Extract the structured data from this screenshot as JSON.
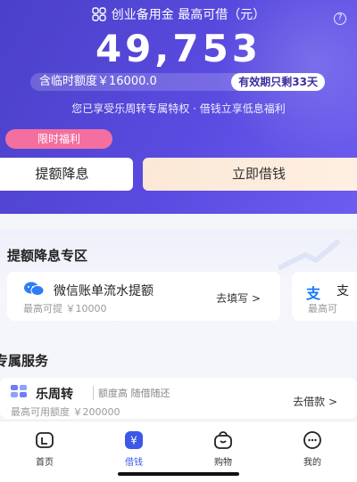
{
  "hero": {
    "title": "创业备用金 最高可借（元）",
    "help_glyph": "?",
    "amount": "49,753",
    "temp_limit": "含临时额度￥16000.0",
    "validity": "有效期只剩33天",
    "privilege": "您已享受乐周转专属特权 · 借钱立享低息福利",
    "promo_tag": "限时福利",
    "raise_button": "提额降息",
    "borrow_button": "立即借钱",
    "colors": {
      "gradient_start": "#4a40c8",
      "gradient_end": "#6d5cf0",
      "promo": "#f36fa0"
    }
  },
  "zone": {
    "title": "提额降息专区",
    "cards": [
      {
        "icon": "wechat-icon",
        "title": "微信账单流水提额",
        "sub": "最高可提 ￥10000",
        "link": "去填写 >"
      },
      {
        "icon": "alipay-icon",
        "icon_glyph": "支",
        "title": "支",
        "sub": "最高可"
      }
    ]
  },
  "services": {
    "title": "专属服务",
    "item": {
      "icon": "brand-icon",
      "name": "乐周转",
      "tag": "额度高 随借随还",
      "sub": "最高可用额度 ￥200000",
      "link": "去借款 >"
    }
  },
  "tabbar": {
    "active_color": "#3d57e8",
    "tabs": [
      {
        "label": "首页",
        "icon": "home-icon",
        "active": false
      },
      {
        "label": "借钱",
        "icon": "yen-icon",
        "active": true
      },
      {
        "label": "购物",
        "icon": "shopping-bag-icon",
        "active": false
      },
      {
        "label": "我的",
        "icon": "profile-icon",
        "active": false
      }
    ]
  }
}
